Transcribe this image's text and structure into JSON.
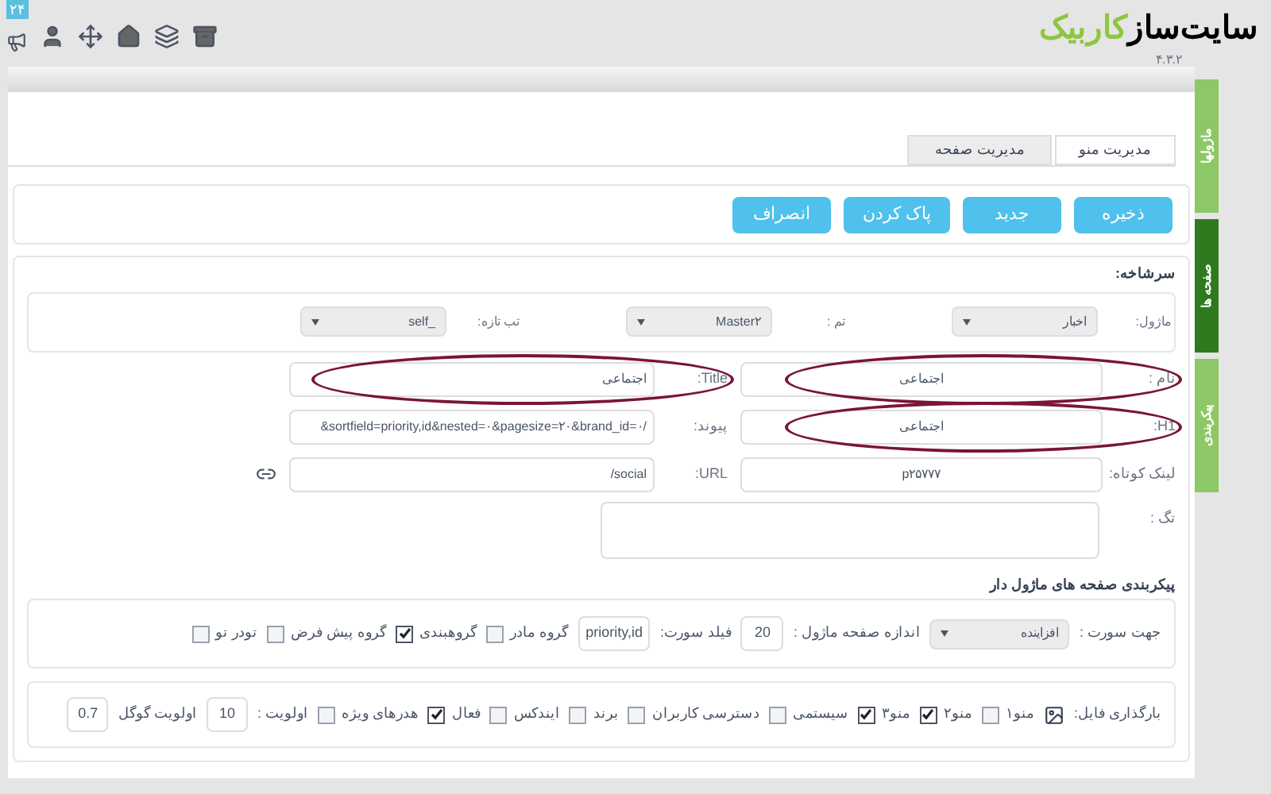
{
  "header": {
    "logo_main": "سایت‌ساز",
    "logo_accent": "کاربیک",
    "version": "۴.۳.۲",
    "badge": "۲۴"
  },
  "tabs": [
    {
      "label": "مدیریت منو",
      "selected": true
    },
    {
      "label": "مدیریت صفحه",
      "selected": false
    }
  ],
  "side_tabs": [
    {
      "label": "ماژولها",
      "selected": false
    },
    {
      "label": "صفحه ها",
      "selected": true
    },
    {
      "label": "پیکربندی",
      "selected": false
    }
  ],
  "buttons": [
    "ذخیره",
    "جدید",
    "پاک کردن",
    "انصراف"
  ],
  "section_title": "سرشاخه:",
  "selects": [
    {
      "label": "ماژول:",
      "value": "اخبار"
    },
    {
      "label": "تم :",
      "value": "Master۲"
    },
    {
      "label": "تب تازه:",
      "value": "_self"
    }
  ],
  "fields_right": [
    {
      "label": "نام :",
      "value": "اجتماعی",
      "circled": true
    },
    {
      "label": "H1:",
      "value": "اجتماعی",
      "circled": true
    },
    {
      "label": "لینک کوتاه:",
      "value": "p۲۵۷۷۷",
      "circled": false
    }
  ],
  "fields_left": [
    {
      "label": "Title:",
      "value": "اجتماعی",
      "circled": true
    },
    {
      "label": "پیوند:",
      "value": "&sortfield=priority,id&nested=۰&pagesize=۲۰&brand_id=۰/",
      "circled": false
    },
    {
      "label": "URL:",
      "value": "/social",
      "circled": false
    }
  ],
  "tag_label": "تگ :",
  "config": {
    "title": "پیکربندی صفحه های ماژول دار",
    "sort_dir_label": "جهت سورت :",
    "sort_dir": "افزاینده",
    "page_size_label": "اندازه صفحه ماژول :",
    "page_size": "20",
    "sort_field_label": "فیلد سورت:",
    "sort_field": "priority,id",
    "options": [
      {
        "label": "گروه مادر",
        "checked": false
      },
      {
        "label": "گروهبندی",
        "checked": true
      },
      {
        "label": "گروه پیش فرض",
        "checked": false
      },
      {
        "label": "تودر تو",
        "checked": false
      }
    ]
  },
  "flags": {
    "upload_label": "بارگذاری فایل:",
    "options": [
      {
        "label": "منو۱",
        "checked": false
      },
      {
        "label": "منو۲",
        "checked": true
      },
      {
        "label": "منو۳",
        "checked": true
      },
      {
        "label": "سیستمی",
        "checked": false
      },
      {
        "label": "دسترسی کاربران",
        "checked": false
      },
      {
        "label": "برند",
        "checked": false
      },
      {
        "label": "ایندکس",
        "checked": false
      },
      {
        "label": "فعال",
        "checked": true
      },
      {
        "label": "هدرهای ویژه",
        "checked": false
      }
    ],
    "priority_label": "اولویت :",
    "priority": "10",
    "google_label": "اولویت گوگل",
    "google": "0.7"
  }
}
